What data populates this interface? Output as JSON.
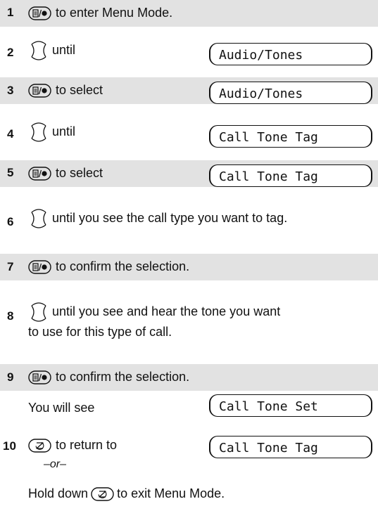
{
  "steps": [
    {
      "n": "1",
      "text": "to enter Menu Mode."
    },
    {
      "n": "2",
      "text": "until",
      "display": "Audio/Tones"
    },
    {
      "n": "3",
      "text": "to select",
      "display": "Audio/Tones"
    },
    {
      "n": "4",
      "text": "until",
      "display": "Call Tone Tag"
    },
    {
      "n": "5",
      "text": "to select",
      "display": "Call Tone Tag"
    },
    {
      "n": "6",
      "text": "until you see the call type you want to tag."
    },
    {
      "n": "7",
      "text": "to confirm the selection."
    },
    {
      "n": "8",
      "text": "until you see and hear the tone you want",
      "text2": "to use for this type of call."
    },
    {
      "n": "9",
      "text": "to confirm the selection.",
      "sub": "You will see",
      "display": "Call Tone Set"
    },
    {
      "n": "10",
      "text": "to return to",
      "display": "Call Tone Tag",
      "or": "–or–",
      "hold_prefix": "Hold down",
      "hold_suffix": "to exit Menu Mode."
    }
  ],
  "icons": {
    "menu_select_key": "menu-select-key-icon",
    "scroll_key": "scroll-key-icon",
    "end_key": "end-key-icon"
  },
  "colors": {
    "band": "#e2e2e2",
    "text": "#111111"
  }
}
